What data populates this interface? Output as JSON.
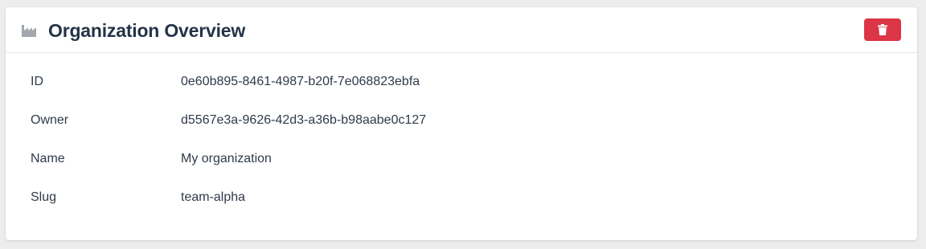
{
  "card": {
    "title": "Organization Overview",
    "icon": "factory-icon",
    "delete_icon": "trash-icon",
    "accent_danger": "#dc3545"
  },
  "fields": [
    {
      "label": "ID",
      "value": "0e60b895-8461-4987-b20f-7e068823ebfa"
    },
    {
      "label": "Owner",
      "value": "d5567e3a-9626-42d3-a36b-b98aabe0c127"
    },
    {
      "label": "Name",
      "value": "My organization"
    },
    {
      "label": "Slug",
      "value": "team-alpha"
    }
  ]
}
